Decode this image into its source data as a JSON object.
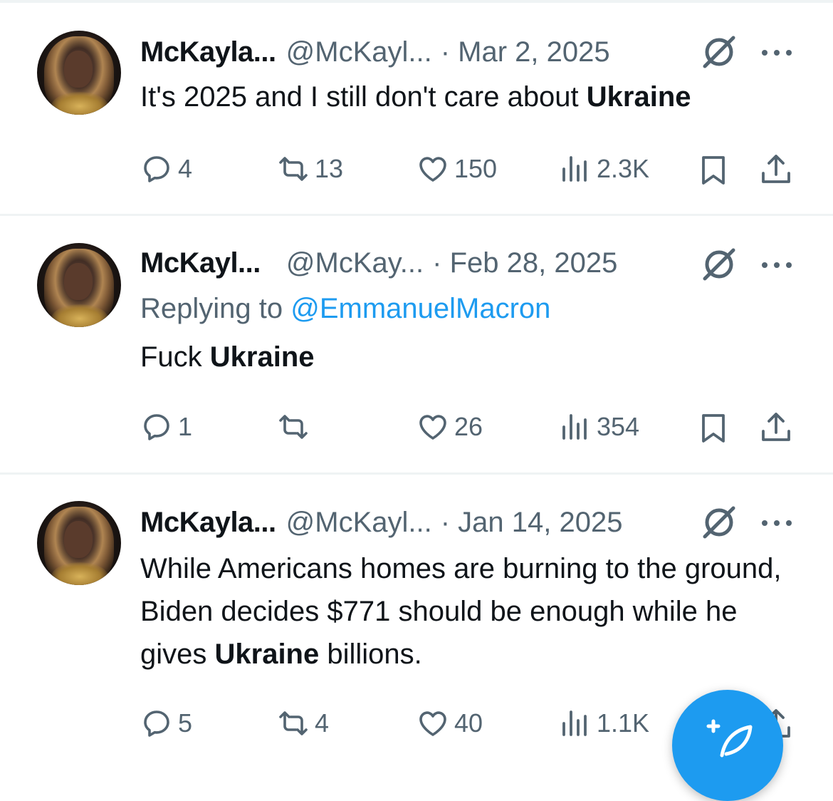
{
  "tweets": [
    {
      "name": "McKayla...",
      "handle": "@McKayl...",
      "date": "· Mar 2, 2025",
      "text_before": "It's 2025 and I still don't care about ",
      "text_bold": "Ukraine",
      "text_after": "",
      "replies": "4",
      "reposts": "13",
      "likes": "150",
      "views": "2.3K"
    },
    {
      "name": "McKayl...",
      "handle": "@McKay...",
      "date": "· Feb 28, 2025",
      "replying_label": "Replying to ",
      "replying_to": "@EmmanuelMacron",
      "text_before": "Fuck ",
      "text_bold": "Ukraine",
      "text_after": "",
      "replies": "1",
      "reposts": "",
      "likes": "26",
      "views": "354"
    },
    {
      "name": "McKayla...",
      "handle": "@McKayl...",
      "date": "· Jan 14, 2025",
      "text_before": "While Americans homes are burning to the ground, Biden decides $771 should be enough while he gives ",
      "text_bold": "Ukraine",
      "text_after": " billions.",
      "replies": "5",
      "reposts": "4",
      "likes": "40",
      "views": "1.1K"
    }
  ],
  "icons": {
    "reply": "reply-icon",
    "repost": "repost-icon",
    "like": "heart-icon",
    "views": "views-chart-icon",
    "bookmark": "bookmark-icon",
    "share": "share-icon",
    "grok": "grok-icon",
    "more": "more-dots-icon",
    "compose": "compose-post-icon"
  },
  "colors": {
    "text": "#0f1419",
    "secondary": "#536471",
    "link": "#1d9bf0",
    "divider": "#eff3f4",
    "fab": "#1d9bf0"
  }
}
